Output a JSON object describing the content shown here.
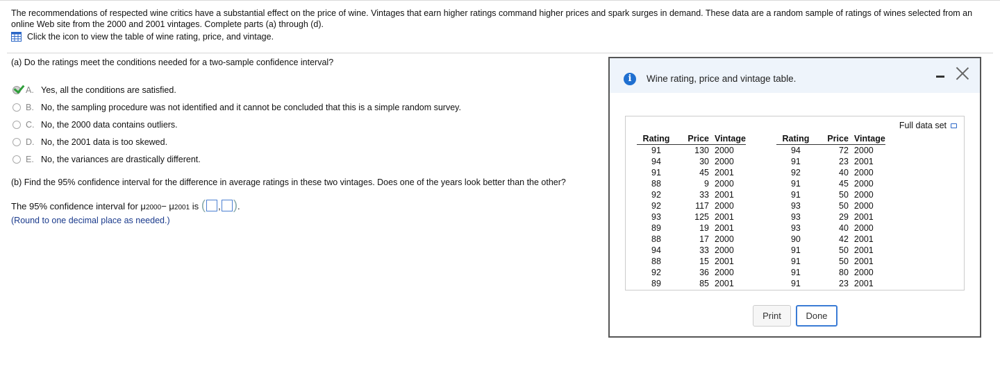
{
  "intro_text": "The recommendations of respected wine critics have a substantial effect on the price of wine. Vintages that earn higher ratings command higher prices and spark surges in demand. These data are a random sample of ratings of wines selected from an online Web site from the 2000 and 2001 vintages. Complete parts (a) through (d).",
  "table_link_text": "Click the icon to view the table of wine rating, price, and vintage.",
  "part_a": {
    "question": "(a) Do the ratings meet the conditions needed for a two-sample confidence interval?",
    "options": [
      {
        "letter": "A.",
        "text": "Yes, all the conditions are satisfied.",
        "selected": true
      },
      {
        "letter": "B.",
        "text": "No, the sampling procedure was not identified and it cannot be concluded that this is a simple random survey.",
        "selected": false
      },
      {
        "letter": "C.",
        "text": "No, the 2000 data contains outliers.",
        "selected": false
      },
      {
        "letter": "D.",
        "text": "No, the 2001 data is too skewed.",
        "selected": false
      },
      {
        "letter": "E.",
        "text": "No, the variances are drastically different.",
        "selected": false
      }
    ]
  },
  "part_b": {
    "question": "(b) Find the 95% confidence interval for the difference in average ratings in these two vintages. Does one of the years look better than the other?",
    "ci_prefix": "The 95% confidence interval for μ",
    "sub1": "2000",
    "minus": " − μ",
    "sub2": "2001",
    "ci_is": " is ",
    "paren_open": "(",
    "comma": ",",
    "paren_close": ")",
    "period": ".",
    "round_note": "(Round to one decimal place as needed.)"
  },
  "dialog": {
    "title": "Wine rating, price and vintage table.",
    "full_data_set": "Full data set",
    "headers": [
      "Rating",
      "Price",
      "Vintage",
      "Rating",
      "Price",
      "Vintage"
    ],
    "rows": [
      [
        "91",
        "130",
        "2000",
        "94",
        "72",
        "2000"
      ],
      [
        "94",
        "30",
        "2000",
        "91",
        "23",
        "2001"
      ],
      [
        "91",
        "45",
        "2001",
        "92",
        "40",
        "2000"
      ],
      [
        "88",
        "9",
        "2000",
        "91",
        "45",
        "2000"
      ],
      [
        "92",
        "33",
        "2001",
        "91",
        "50",
        "2000"
      ],
      [
        "92",
        "117",
        "2000",
        "93",
        "50",
        "2000"
      ],
      [
        "93",
        "125",
        "2001",
        "93",
        "29",
        "2001"
      ],
      [
        "89",
        "19",
        "2001",
        "93",
        "40",
        "2000"
      ],
      [
        "88",
        "17",
        "2000",
        "90",
        "42",
        "2001"
      ],
      [
        "94",
        "33",
        "2000",
        "91",
        "50",
        "2001"
      ],
      [
        "88",
        "15",
        "2001",
        "91",
        "50",
        "2001"
      ],
      [
        "92",
        "36",
        "2000",
        "91",
        "80",
        "2000"
      ],
      [
        "89",
        "85",
        "2001",
        "91",
        "23",
        "2001"
      ]
    ],
    "print_label": "Print",
    "done_label": "Done"
  },
  "colors": {
    "accent": "#1f6fd0",
    "note": "#1a3a8c",
    "check": "#2e9e3a"
  }
}
